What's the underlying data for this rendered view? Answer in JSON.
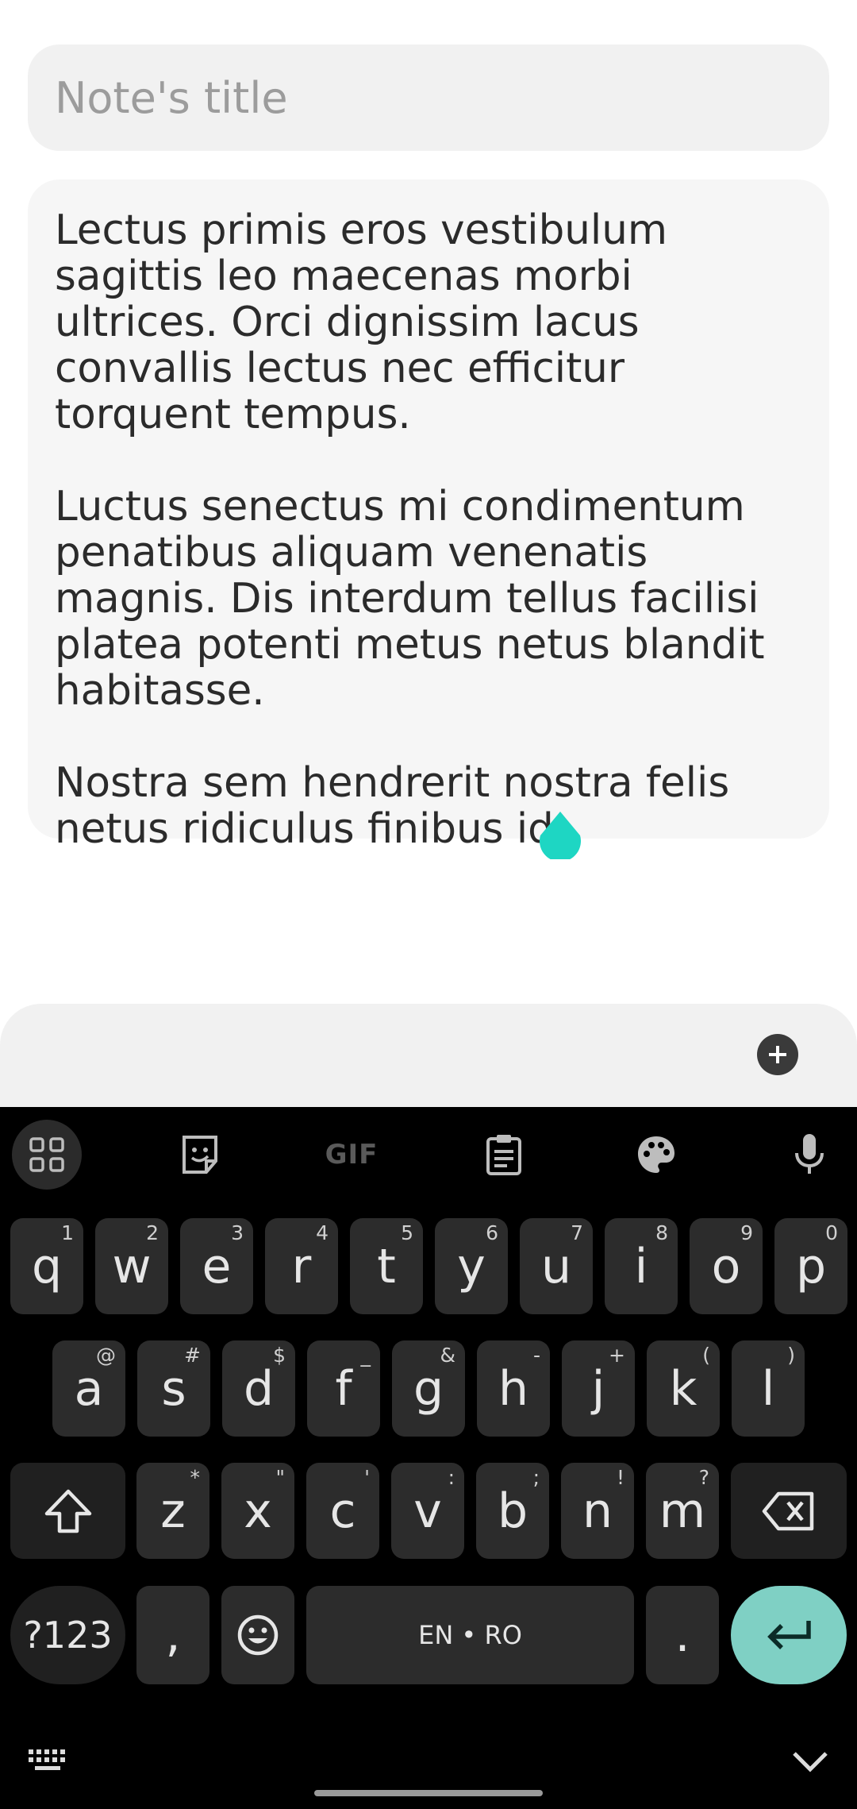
{
  "note": {
    "title_placeholder": "Note's title",
    "body_text": "Lectus primis eros vestibulum sagittis leo maecenas morbi ultrices. Orci dignissim lacus convallis lectus nec efficitur torquent tempus.\n\nLuctus senectus mi condimentum penatibus aliquam venenatis magnis. Dis interdum tellus facilisi platea potenti metus netus blandit habitasse.\n\nNostra sem hendrerit nostra felis netus ridiculus finibus id."
  },
  "colors": {
    "cursor_handle": "#1ed6c3",
    "enter_key": "#7fd0c4"
  },
  "keyboard": {
    "toolbar": {
      "icons": [
        "apps-grid-icon",
        "sticker-icon",
        "gif-icon",
        "clipboard-icon",
        "palette-icon",
        "microphone-icon"
      ],
      "gif_label": "GIF"
    },
    "row1": [
      {
        "k": "q",
        "s": "1"
      },
      {
        "k": "w",
        "s": "2"
      },
      {
        "k": "e",
        "s": "3"
      },
      {
        "k": "r",
        "s": "4"
      },
      {
        "k": "t",
        "s": "5"
      },
      {
        "k": "y",
        "s": "6"
      },
      {
        "k": "u",
        "s": "7"
      },
      {
        "k": "i",
        "s": "8"
      },
      {
        "k": "o",
        "s": "9"
      },
      {
        "k": "p",
        "s": "0"
      }
    ],
    "row2": [
      {
        "k": "a",
        "s": "@"
      },
      {
        "k": "s",
        "s": "#"
      },
      {
        "k": "d",
        "s": "$"
      },
      {
        "k": "f",
        "s": "_"
      },
      {
        "k": "g",
        "s": "&"
      },
      {
        "k": "h",
        "s": "-"
      },
      {
        "k": "j",
        "s": "+"
      },
      {
        "k": "k",
        "s": "("
      },
      {
        "k": "l",
        "s": ")"
      }
    ],
    "row3": [
      {
        "k": "z",
        "s": "*"
      },
      {
        "k": "x",
        "s": "\""
      },
      {
        "k": "c",
        "s": "'"
      },
      {
        "k": "v",
        "s": ":"
      },
      {
        "k": "b",
        "s": ";"
      },
      {
        "k": "n",
        "s": "!"
      },
      {
        "k": "m",
        "s": "?"
      }
    ],
    "symbols_label": "?123",
    "comma": ",",
    "space_label": "EN • RO",
    "period": "."
  }
}
